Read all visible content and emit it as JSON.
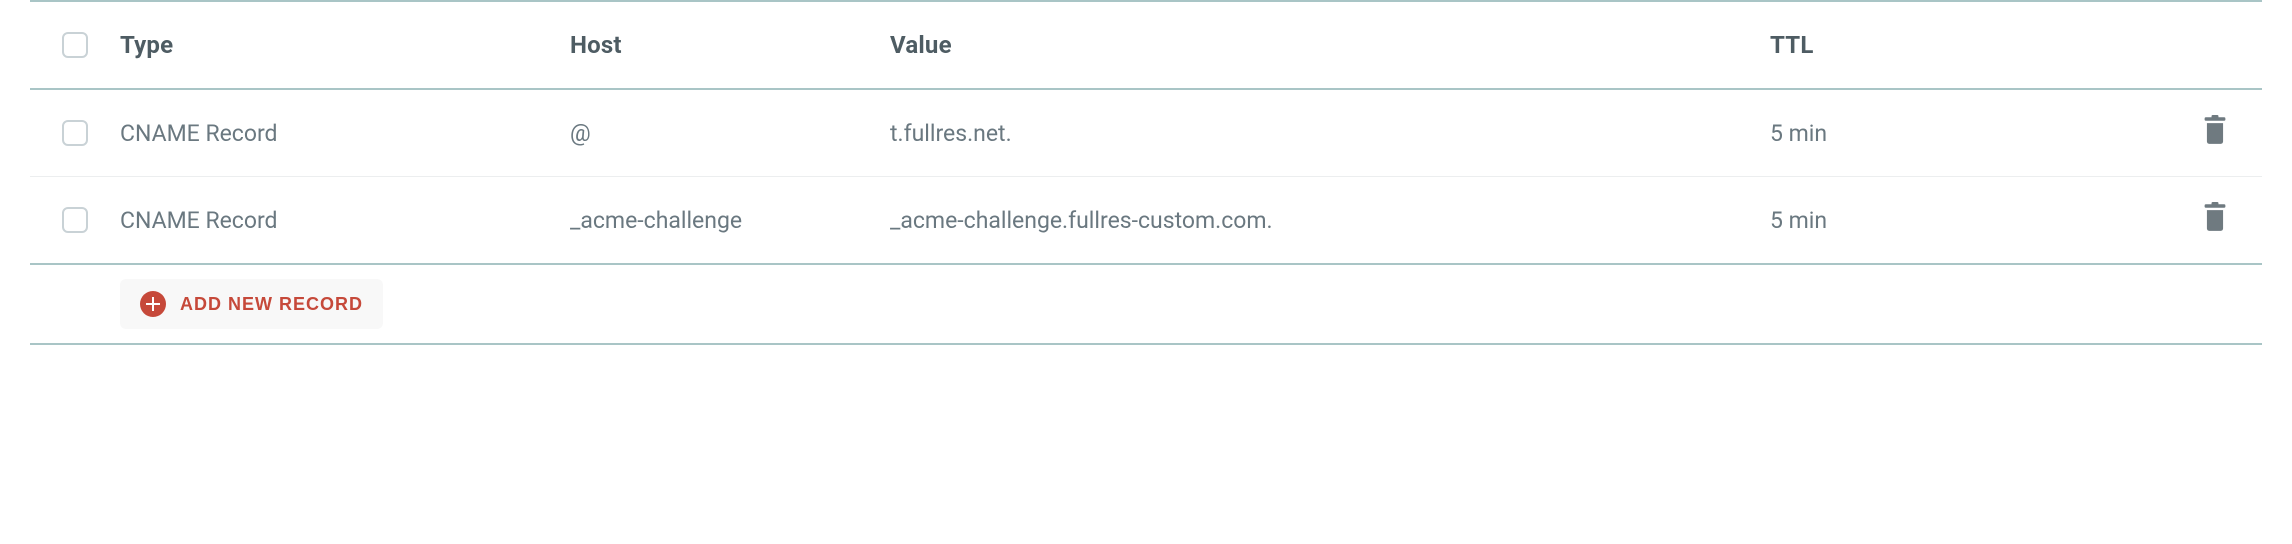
{
  "table": {
    "headers": {
      "type": "Type",
      "host": "Host",
      "value": "Value",
      "ttl": "TTL"
    },
    "rows": [
      {
        "type": "CNAME Record",
        "host": "@",
        "value": "t.fullres.net.",
        "ttl": "5 min"
      },
      {
        "type": "CNAME Record",
        "host": "_acme-challenge",
        "value": "_acme-challenge.fullres-custom.com.",
        "ttl": "5 min"
      }
    ]
  },
  "actions": {
    "add_label": "ADD NEW RECORD"
  }
}
